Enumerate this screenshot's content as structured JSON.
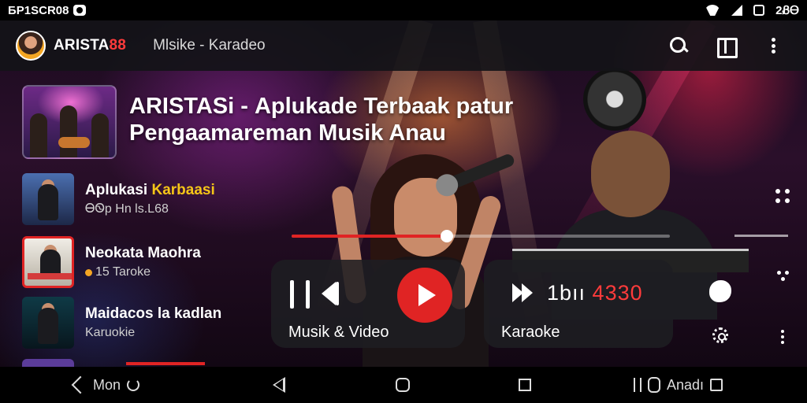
{
  "status_bar": {
    "left_text": "ƂP1SCR08",
    "time": "2ᏰᎾ"
  },
  "header": {
    "brand_part1": "ARISTA",
    "brand_part2": "88",
    "subtitle": "Mlsike - Karadeo",
    "colors": {
      "accent": "#e02424",
      "brand_red": "#ff3b3b",
      "highlight": "#f5c518"
    }
  },
  "hero": {
    "title_line1": "ARISTASі - Aplukade Terbaak patur",
    "title_line2": "Pengaamareman Musik Anau"
  },
  "list": [
    {
      "title_plain": "Aplukasi ",
      "title_highlight": "Karbaasi",
      "subtitle": "ᎾᏫp Hn ls.L68"
    },
    {
      "title_plain": "Neokata Maohra",
      "title_highlight": "",
      "subtitle": "15 Taroke"
    },
    {
      "title_plain": "Maidacos la kadlan",
      "title_highlight": "",
      "subtitle": "Karuokie"
    }
  ],
  "player": {
    "progress_fraction": 0.41,
    "music_card_label": "Musik & Video",
    "karaoke_card_label": "Karaoke",
    "counter_plain": "1bıı ",
    "counter_red": "4330"
  },
  "navbar": {
    "left_label": "Mon",
    "right_label": "Anadı"
  },
  "icons": [
    "search-icon",
    "cast-icon",
    "more-vert-icon",
    "play-icon",
    "previous-icon",
    "fast-forward-icon",
    "settings-icon",
    "back-icon",
    "home-icon",
    "recents-icon"
  ]
}
